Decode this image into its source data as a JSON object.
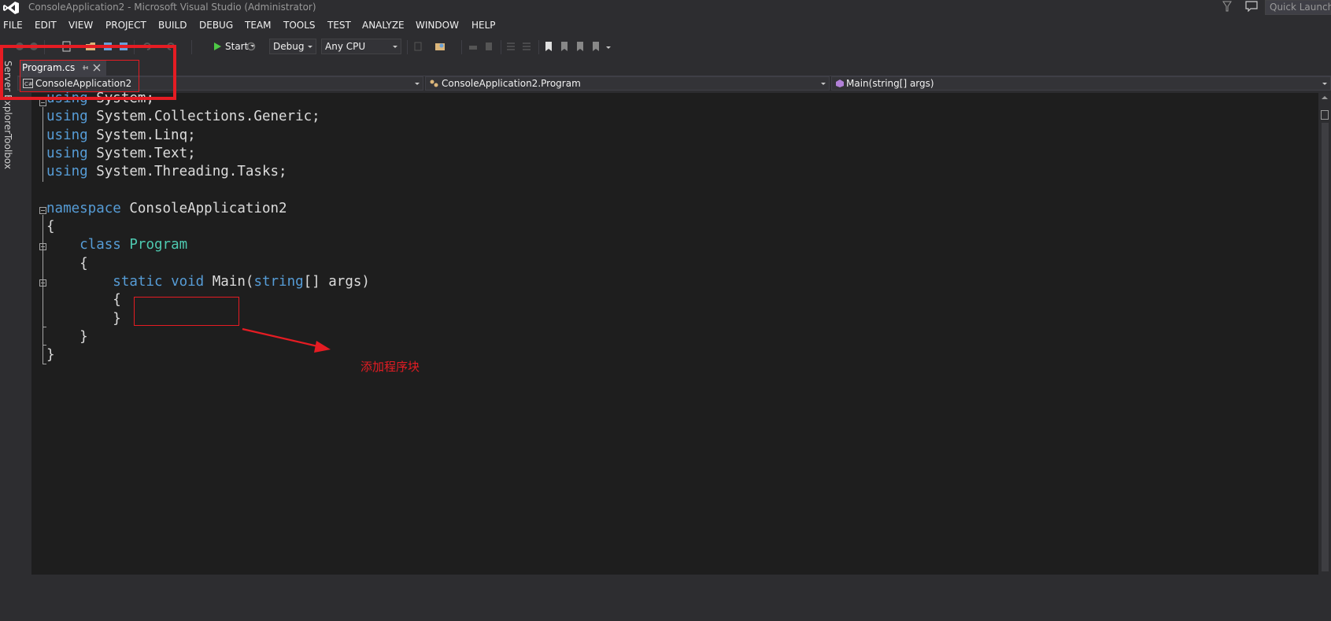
{
  "window": {
    "title": "ConsoleApplication2 - Microsoft Visual Studio (Administrator)",
    "quick_launch": "Quick Launch"
  },
  "menu": [
    "FILE",
    "EDIT",
    "VIEW",
    "PROJECT",
    "BUILD",
    "DEBUG",
    "TEAM",
    "TOOLS",
    "TEST",
    "ANALYZE",
    "WINDOW",
    "HELP"
  ],
  "toolbar": {
    "start_label": "Start",
    "config": "Debug",
    "platform": "Any CPU"
  },
  "side_tabs": [
    "Server Explorer",
    "Toolbox"
  ],
  "document_tab": {
    "label": "Program.cs"
  },
  "navigation": {
    "project": "ConsoleApplication2",
    "class": "ConsoleApplication2.Program",
    "member": "Main(string[] args)"
  },
  "code": {
    "lines": [
      [
        {
          "t": "using",
          "c": "kw"
        },
        {
          "t": " System;",
          "c": ""
        }
      ],
      [
        {
          "t": "using",
          "c": "kw"
        },
        {
          "t": " System.Collections.Generic;",
          "c": ""
        }
      ],
      [
        {
          "t": "using",
          "c": "kw"
        },
        {
          "t": " System.Linq;",
          "c": ""
        }
      ],
      [
        {
          "t": "using",
          "c": "kw"
        },
        {
          "t": " System.Text;",
          "c": ""
        }
      ],
      [
        {
          "t": "using",
          "c": "kw"
        },
        {
          "t": " System.Threading.Tasks;",
          "c": ""
        }
      ],
      [],
      [
        {
          "t": "namespace",
          "c": "kw"
        },
        {
          "t": " ConsoleApplication2",
          "c": ""
        }
      ],
      [
        {
          "t": "{",
          "c": ""
        }
      ],
      [
        {
          "t": "    ",
          "c": ""
        },
        {
          "t": "class",
          "c": "kw"
        },
        {
          "t": " ",
          "c": ""
        },
        {
          "t": "Program",
          "c": "ty"
        }
      ],
      [
        {
          "t": "    {",
          "c": ""
        }
      ],
      [
        {
          "t": "        ",
          "c": ""
        },
        {
          "t": "static",
          "c": "kw"
        },
        {
          "t": " ",
          "c": ""
        },
        {
          "t": "void",
          "c": "kw"
        },
        {
          "t": " Main(",
          "c": ""
        },
        {
          "t": "string",
          "c": "kw"
        },
        {
          "t": "[] args)",
          "c": ""
        }
      ],
      [
        {
          "t": "        {",
          "c": ""
        }
      ],
      [
        {
          "t": "        }",
          "c": ""
        }
      ],
      [
        {
          "t": "    }",
          "c": ""
        }
      ],
      [
        {
          "t": "}",
          "c": ""
        }
      ]
    ]
  },
  "annotation": {
    "text": "添加程序块"
  },
  "colors": {
    "keyword": "#569cd6",
    "type": "#4ec9b0",
    "annotation": "#e51c23"
  }
}
